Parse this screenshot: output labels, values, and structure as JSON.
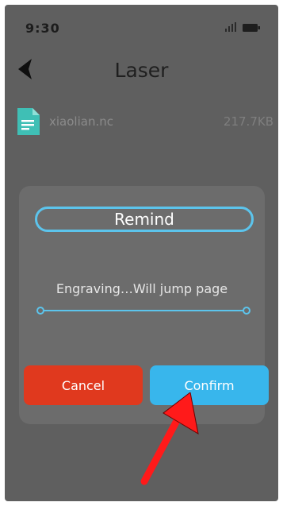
{
  "status_bar": {
    "time": "9:30",
    "signal_icon": "signal-icon",
    "battery_icon": "battery-icon"
  },
  "header": {
    "back_icon": "arrow-back-icon",
    "title": "Laser"
  },
  "file": {
    "icon": "document-icon",
    "name": "xiaolian.nc",
    "size": "217.7KB"
  },
  "dialog": {
    "title": "Remind",
    "message": "Engraving…Will jump page",
    "cancel_label": "Cancel",
    "confirm_label": "Confirm"
  },
  "colors": {
    "background": "#5f5f5f",
    "dialog": "#6c6c6c",
    "accent": "#5cc4ec",
    "cancel": "#e0391e",
    "confirm": "#38b6ec",
    "file_icon": "#3fbfb5",
    "annotation_arrow": "#ff1a1a"
  }
}
